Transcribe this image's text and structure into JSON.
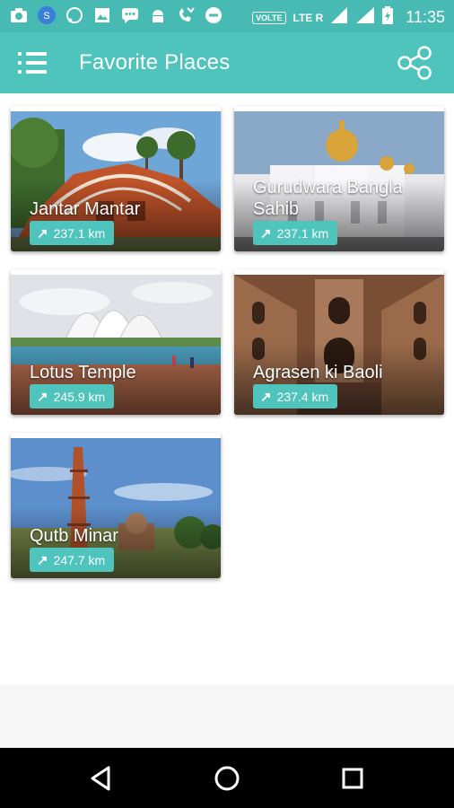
{
  "status_bar": {
    "time": "11:35",
    "volte": "VOLTE",
    "lte": "LTE R",
    "icons": [
      "camera-icon",
      "app-icon",
      "whatsapp-icon",
      "gallery-icon",
      "message-icon",
      "android-icon",
      "missed-call-icon",
      "do-not-disturb-icon",
      "signal-icon",
      "signal-icon",
      "battery-icon"
    ]
  },
  "app_bar": {
    "title": "Favorite Places",
    "menu_icon": "menu-icon",
    "share_icon": "share-icon"
  },
  "places": [
    {
      "name": "Jantar Mantar",
      "distance": "237.1 km"
    },
    {
      "name": "Gurudwara Bangla Sahib",
      "distance": "237.1 km"
    },
    {
      "name": "Lotus Temple",
      "distance": "245.9 km"
    },
    {
      "name": "Agrasen ki Baoli",
      "distance": "237.4 km"
    },
    {
      "name": "Qutb Minar",
      "distance": "247.7 km"
    }
  ],
  "colors": {
    "accent": "#4ec4bd",
    "status_bar": "#48bab4",
    "nav_bar": "#000000"
  },
  "nav_bar": {
    "icons": [
      "back-icon",
      "home-icon",
      "recents-icon"
    ]
  }
}
